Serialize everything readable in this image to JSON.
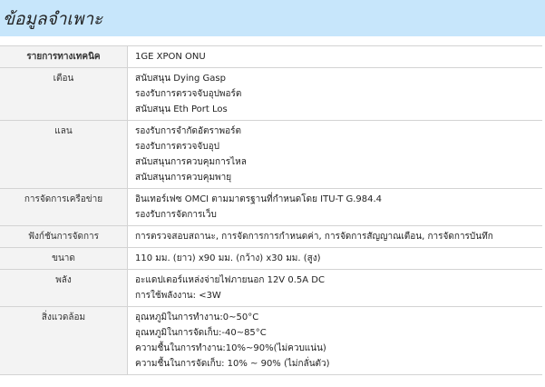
{
  "header": {
    "title": "ข้อมูลจำเพาะ"
  },
  "rows": [
    {
      "label": "รายการทางเทคนิค",
      "lines": [
        "1GE XPON ONU"
      ]
    },
    {
      "label": "เตือน",
      "lines": [
        "สนับสนุน Dying Gasp",
        "รองรับการตรวจจับอุปพอร์ต",
        "สนับสนุน Eth Port Los"
      ]
    },
    {
      "label": "แลน",
      "lines": [
        "รองรับการจำกัดอัตราพอร์ต",
        " รองรับการตรวจจับอุป",
        " สนับสนุนการควบคุมการไหล",
        "สนับสนุนการควบคุมพายุ"
      ]
    },
    {
      "label": "การจัดการเครือข่าย",
      "lines": [
        "อินเทอร์เฟซ OMCI ตามมาตรฐานที่กำหนดโดย ITU-T G.984.4",
        " รองรับการจัดการเว็บ"
      ]
    },
    {
      "label": "ฟังก์ชันการจัดการ",
      "lines": [
        "การตรวจสอบสถานะ, การจัดการการกำหนดค่า, การจัดการสัญญาณเตือน, การจัดการบันทึก"
      ]
    },
    {
      "label": "ขนาด",
      "lines": [
        "110 มม. (ยาว) x90 มม. (กว้าง) x30 มม. (สูง)"
      ]
    },
    {
      "label": "พลัง",
      "lines": [
        "อะแดปเตอร์แหล่งจ่ายไฟภายนอก 12V 0.5A DC",
        "การใช้พลังงาน: <3W"
      ]
    },
    {
      "label": "สิ่งแวดล้อม",
      "lines": [
        "อุณหภูมิในการทำงาน:0~50°C",
        " อุณหภูมิในการจัดเก็บ:-40~85°C",
        "ความชื้นในการทำงาน:10%~90%(ไม่ควบแน่น)",
        "ความชื้นในการจัดเก็บ: 10% ~ 90% (ไม่กลั่นตัว)"
      ]
    }
  ]
}
